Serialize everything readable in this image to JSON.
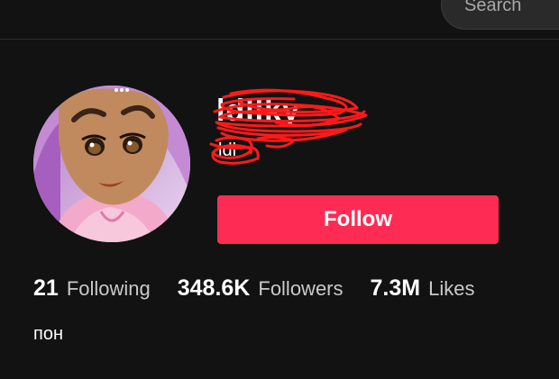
{
  "header": {
    "search_label": "Search"
  },
  "profile": {
    "username": "ldllky",
    "nickname": "ldl",
    "follow_label": "Follow",
    "bio": "пон"
  },
  "stats": [
    {
      "value": "21",
      "label": "Following"
    },
    {
      "value": "348.6K",
      "label": "Followers"
    },
    {
      "value": "7.3M",
      "label": "Likes"
    }
  ],
  "colors": {
    "background": "#121212",
    "accent": "#fe2c55",
    "scribble": "#ff1a1a"
  }
}
